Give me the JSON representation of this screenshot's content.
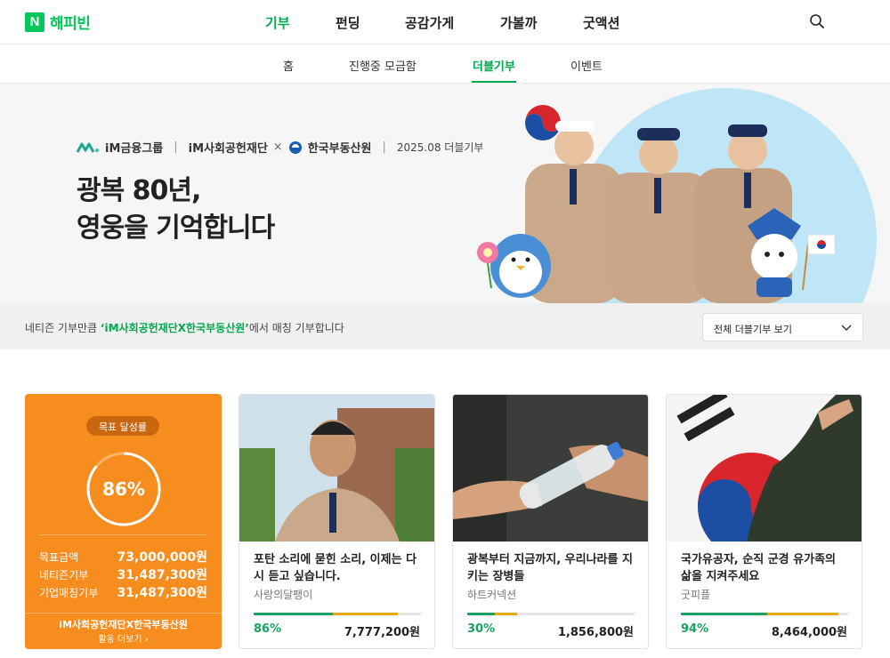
{
  "brand": {
    "box": "N",
    "name": "해피빈",
    "color": "#03c75a"
  },
  "gnb": [
    "기부",
    "펀딩",
    "공감가게",
    "가볼까",
    "굿액션"
  ],
  "gnb_active": "기부",
  "subnav": [
    "홈",
    "진행중 모금함",
    "더블기부",
    "이벤트"
  ],
  "subnav_active": "더블기부",
  "banner": {
    "partner_1": "iM금융그룹",
    "partner_2": "iM사회공헌재단",
    "partner_x": "×",
    "partner_3": "한국부동산원",
    "date": "2025.08 더블기부",
    "title_line1": "광복 80년,",
    "title_line2": "영웅을 기억합니다"
  },
  "notice": {
    "prefix": "네티즌 기부만큼 ",
    "highlight": "‘iM사회공헌재단X한국부동산원’",
    "suffix": "에서 매칭 기부합니다",
    "select_label": "전체 더블기부 보기"
  },
  "goal": {
    "badge": "목표 달성률",
    "percent_label": "86%",
    "percent": 0.86,
    "rows": [
      {
        "label": "목표금액",
        "value": "73,000,000원"
      },
      {
        "label": "네티즌기부",
        "value": "31,487,300원"
      },
      {
        "label": "기업매칭기부",
        "value": "31,487,300원"
      }
    ],
    "foot_title": "iM사회공헌재단X한국부동산원",
    "foot_more": "활동 더보기 ›"
  },
  "cards": [
    {
      "title": "포탄 소리에 묻힌 소리, 이제는 다시 듣고 싶습니다.",
      "org": "사랑의달팽이",
      "pct_label": "86%",
      "pct": 0.86,
      "amount": "7,777,200원"
    },
    {
      "title": "광복부터 지금까지, 우리나라를 지키는 장병들",
      "org": "하트커넥션",
      "pct_label": "30%",
      "pct": 0.3,
      "amount": "1,856,800원"
    },
    {
      "title": "국가유공자, 순직 군경 유가족의 삶을 지켜주세요",
      "org": "굿피플",
      "pct_label": "94%",
      "pct": 0.94,
      "amount": "8,464,000원"
    }
  ],
  "colors": {
    "accent": "#03a94f",
    "goal_card": "#f78c1f",
    "progress_green": "#1aa260",
    "progress_gold": "#e8a81c"
  }
}
